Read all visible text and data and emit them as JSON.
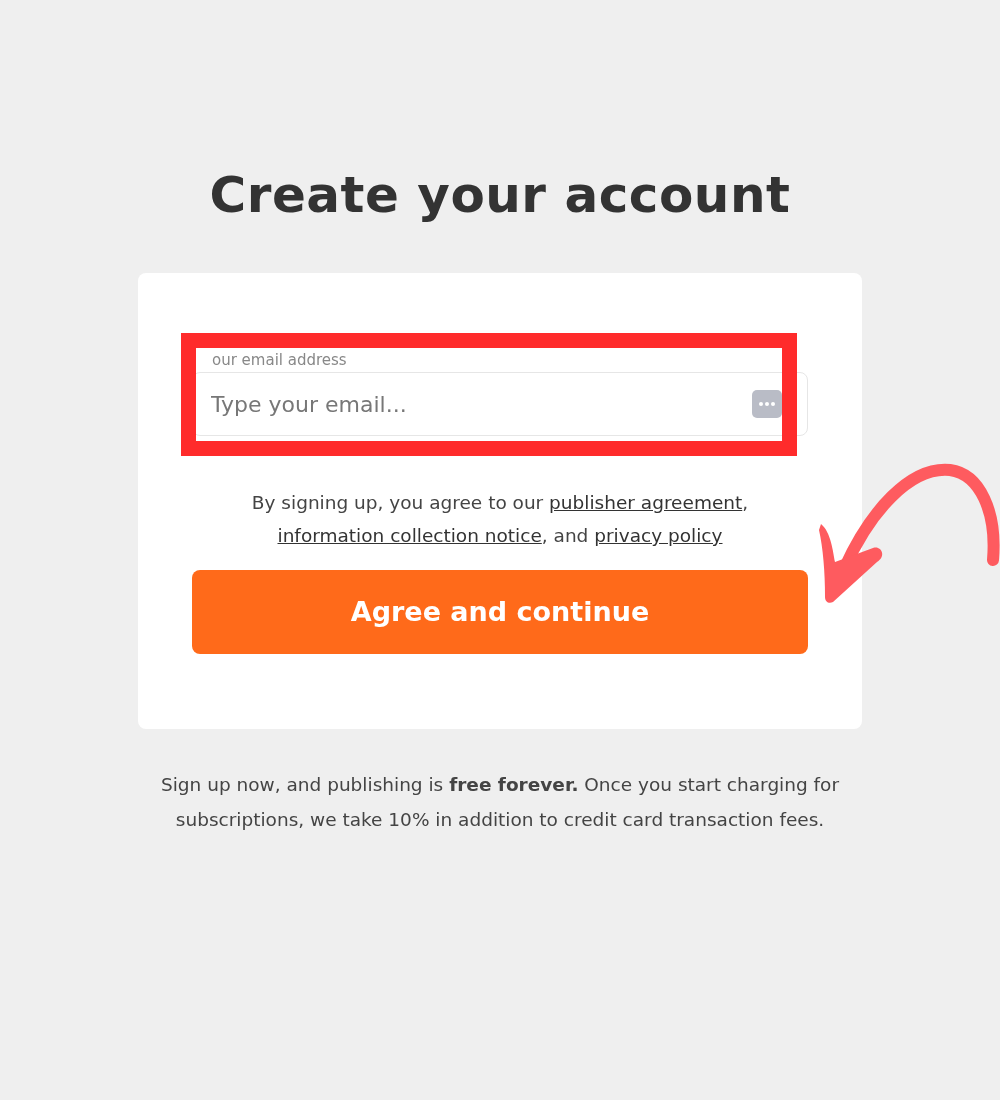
{
  "heading": "Create your account",
  "email_field": {
    "label": "our email address",
    "placeholder": "Type your email..."
  },
  "agreement": [
    {
      "kind": "text",
      "text": "By signing up, you agree to our "
    },
    {
      "kind": "link",
      "text": "publisher agreement"
    },
    {
      "kind": "text",
      "text": ", "
    },
    {
      "kind": "link",
      "text": "information collection notice"
    },
    {
      "kind": "text",
      "text": ", and "
    },
    {
      "kind": "link",
      "text": "privacy policy"
    }
  ],
  "submit_button": "Agree and continue",
  "footer_note": "Sign up now, and publishing is **free forever.** Once you start charging for subscriptions, we take 10% in addition to credit card transaction fees."
}
